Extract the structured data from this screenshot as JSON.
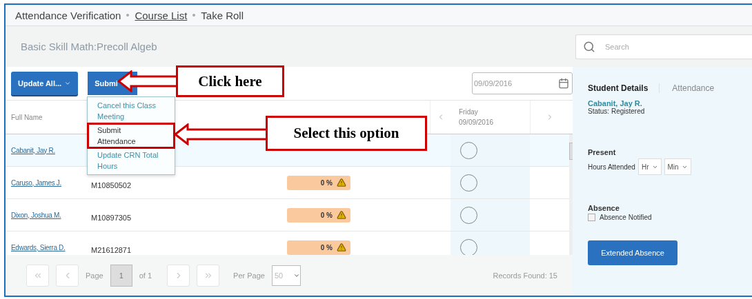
{
  "breadcrumb": [
    {
      "label": "Attendance Verification",
      "link": false
    },
    {
      "label": "Course List",
      "link": true
    },
    {
      "label": "Take Roll",
      "link": false
    }
  ],
  "course_title": "Basic Skill Math:Precoll Algeb",
  "search": {
    "placeholder": "Search"
  },
  "toolbar": {
    "update_button": "Update All...",
    "submit_button": "Submi",
    "date": "09/09/2016"
  },
  "submit_menu": [
    {
      "label": "Cancel this Class Meeting",
      "selected": false
    },
    {
      "label": "Submit Attendance",
      "selected": true
    },
    {
      "label": "Update CRN Total Hours",
      "selected": false
    }
  ],
  "table": {
    "columns": [
      "Full Name"
    ],
    "day": {
      "name": "Friday",
      "date": "09/09/2016"
    },
    "rows": [
      {
        "name": "Cabanit, Jay R.",
        "selected": true
      },
      {
        "name": "Caruso, James J.",
        "id": "M10850502",
        "percent": "0 %",
        "selected": false
      },
      {
        "name": "Dixon, Joshua M.",
        "id": "M10897305",
        "percent": "0 %",
        "selected": false
      },
      {
        "name": "Edwards, Sierra D.",
        "id": "M21612871",
        "percent": "0 %",
        "selected": false
      }
    ]
  },
  "pagination": {
    "page_label": "Page",
    "page": "1",
    "of": "of 1",
    "per_page_label": "Per Page",
    "per_page": "50",
    "records": "Records Found: 15"
  },
  "details": {
    "tabs": [
      {
        "label": "Student Details",
        "selected": true
      },
      {
        "label": "Attendance",
        "selected": false
      }
    ],
    "student": "Cabanit, Jay R.",
    "status": "Status: Registered",
    "present_heading": "Present",
    "hours_label": "Hours Attended",
    "hours": "Hr",
    "minutes": "Min",
    "absence_heading": "Absence",
    "absence_notified": {
      "label": "Absence Notified",
      "checked": false
    },
    "extended_button": "Extended Absence"
  },
  "callouts": [
    {
      "text": "Click here"
    },
    {
      "text": "Select this option"
    }
  ]
}
